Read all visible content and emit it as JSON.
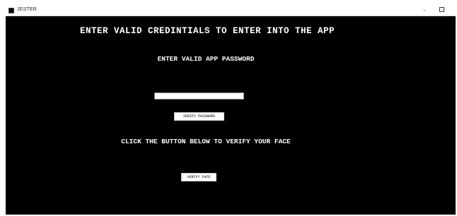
{
  "window": {
    "title": "JESTER",
    "icon": "app-window-icon",
    "controls": {
      "minimize_glyph": "–",
      "maximize_icon": "maximize-square-icon"
    }
  },
  "content": {
    "main_heading": "ENTER VALID CREDINTIALS TO ENTER INTO THE APP",
    "password_heading": "ENTER VALID APP PASSWORD",
    "password_input": {
      "value": "",
      "placeholder": ""
    },
    "verify_password_label": "VERIFY PASSWORD",
    "face_heading": "CLICK THE BUTTON BELOW TO VERIFY YOUR FACE",
    "verify_face_label": "VERIFY FACE"
  },
  "colors": {
    "background": "#000000",
    "text": "#ffffff",
    "button_bg": "#ffffff",
    "button_text": "#000000"
  }
}
